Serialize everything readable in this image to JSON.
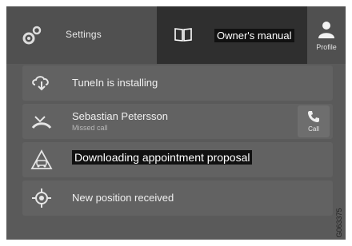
{
  "topbar": {
    "settings": {
      "label": "Settings",
      "icon": "gear-icon"
    },
    "manual": {
      "label": "Owner's manual",
      "icon": "book-icon"
    },
    "profile": {
      "label": "Profile",
      "icon": "person-icon"
    }
  },
  "notifications": [
    {
      "text": "TuneIn is installing",
      "icon": "cloud-download-icon"
    },
    {
      "text": "Sebastian Petersson",
      "subtext": "Missed call",
      "icon": "missed-call-icon",
      "action": {
        "label": "Call",
        "icon": "phone-icon"
      }
    },
    {
      "text": "Downloading appointment proposal",
      "icon": "car-service-icon"
    },
    {
      "text": "New position received",
      "icon": "gps-position-icon"
    }
  ],
  "image_code": "G063375",
  "colors": {
    "background": "#5a5a5a",
    "active_tab": "#2f2f2f",
    "row": "#626262"
  }
}
